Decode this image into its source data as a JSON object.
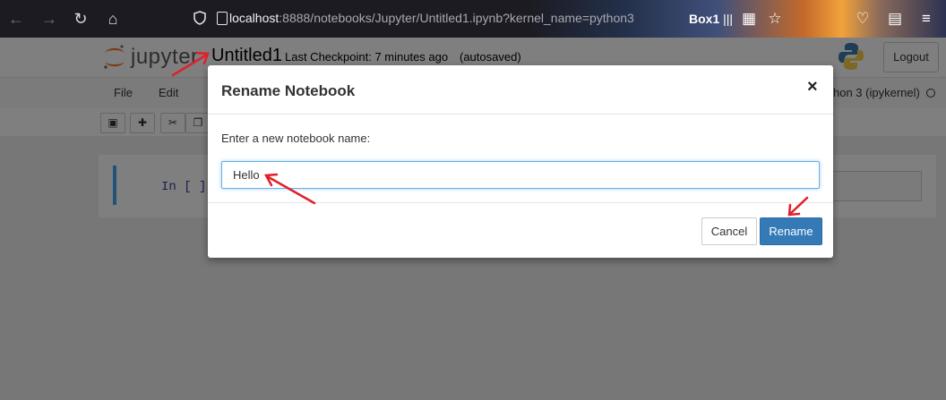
{
  "browser": {
    "url_host": "localhost",
    "url_rest": ":8888/notebooks/Jupyter/Untitled1.ipynb?kernel_name=python3",
    "profile_label": "Box1",
    "icons": [
      "back-icon",
      "forward-icon",
      "reload-icon",
      "home-icon",
      "shield-icon",
      "page-icon",
      "grid-icon",
      "star-icon",
      "pocket-icon",
      "document-icon",
      "menu-icon"
    ]
  },
  "header": {
    "logo_text": "jupyter",
    "notebook_name": "Untitled1",
    "checkpoint": "Last Checkpoint: 7 minutes ago",
    "autosave": "(autosaved)",
    "logout_label": "Logout"
  },
  "menu": {
    "items": [
      "File",
      "Edit"
    ],
    "kernel_label": "hon 3 (ipykernel)"
  },
  "cell": {
    "prompt": "In [ ]:"
  },
  "dialog": {
    "title": "Rename Notebook",
    "close_glyph": "×",
    "prompt": "Enter a new notebook name:",
    "input_value": "Hello",
    "cancel_label": "Cancel",
    "rename_label": "Rename"
  },
  "colors": {
    "primary_button": "#337ab7",
    "input_focus": "#66afe9",
    "annotation_arrow": "#e0202a",
    "cell_selected_bar": "#42a5f5"
  }
}
